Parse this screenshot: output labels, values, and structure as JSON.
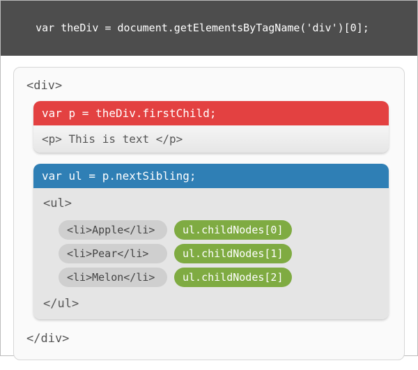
{
  "top_code": "var theDiv = document.getElementsByTagName('div')[0];",
  "outer": {
    "open": "<div>",
    "close": "</div>"
  },
  "first": {
    "code": "var p = theDiv.firstChild;",
    "markup": "<p> This is text </p>"
  },
  "second": {
    "code": "var ul = p.nextSibling;",
    "open": "<ul>",
    "close": "</ul>",
    "items": [
      {
        "markup": "<li>Apple</li>",
        "note": "ul.childNodes[0]"
      },
      {
        "markup": "<li>Pear</li>",
        "note": "ul.childNodes[1]"
      },
      {
        "markup": "<li>Melon</li>",
        "note": "ul.childNodes[2]"
      }
    ]
  }
}
